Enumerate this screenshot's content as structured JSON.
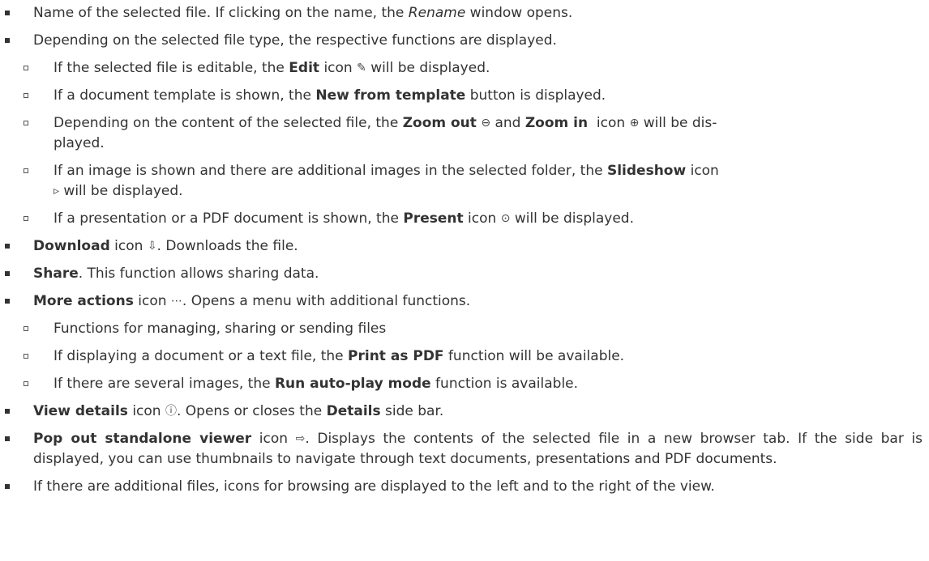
{
  "items": [
    {
      "pre": "Name of the selected file. If clicking on the name, the ",
      "em": "Rename",
      "post": " window opens."
    },
    {
      "text": "Depending on the selected file type, the respective functions are displayed.",
      "sub": [
        {
          "pre": "If the selected file is editable, the ",
          "b": "Edit",
          "mid": " icon ",
          "icon": "✎",
          "icon_name": "pencil-icon",
          "post": " will be displayed."
        },
        {
          "pre": "If a document template is shown, the ",
          "b": "New from template",
          "post": " button is displayed."
        },
        {
          "pre": "Depending on the content of the selected file, the ",
          "b1": "Zoom out",
          "icon1": "⊖",
          "mid": " and ",
          "b2": "Zoom in",
          "mid2": "  icon ",
          "icon2": "⊕",
          "post": " will be dis-",
          "cont": "played."
        },
        {
          "pre": "If an image is shown and there are additional images in the selected folder, the ",
          "b": "Slideshow",
          "post": " icon",
          "icon": "▹",
          "cont": " will be displayed."
        },
        {
          "pre": "If a presentation or a PDF document is shown, the ",
          "b": "Present",
          "mid": " icon ",
          "icon": "⊙",
          "post": " will be displayed."
        }
      ]
    },
    {
      "b": "Download",
      "mid": " icon ",
      "icon": "⇩",
      "post": ". Downloads the file."
    },
    {
      "b": "Share",
      "post": ". This function allows sharing data."
    },
    {
      "b": "More actions",
      "mid": " icon ",
      "icon": "⋯",
      "post": ". Opens a menu with additional functions.",
      "sub": [
        {
          "text": "Functions for managing, sharing or sending files"
        },
        {
          "pre": "If displaying a document or a text file, the ",
          "b": "Print as PDF",
          "post": " function will be available."
        },
        {
          "pre": "If there are several images, the ",
          "b": "Run auto-play mode",
          "post": " function is available."
        }
      ]
    },
    {
      "b": "View details",
      "mid": " icon ",
      "icon": "ⓘ",
      "post": ". Opens or closes the ",
      "b2": "Details",
      "post2": " side bar."
    },
    {
      "b": "Pop out standalone viewer",
      "mid": " icon ",
      "icon": "⇨",
      "post": ". Displays the contents of the selected file in a new browser tab. If the side bar is displayed, you can use thumbnails to navigate through text documents, presentations and PDF documents."
    },
    {
      "text": "If there are additional files, icons for browsing are displayed to the left and to the right of the view."
    }
  ]
}
